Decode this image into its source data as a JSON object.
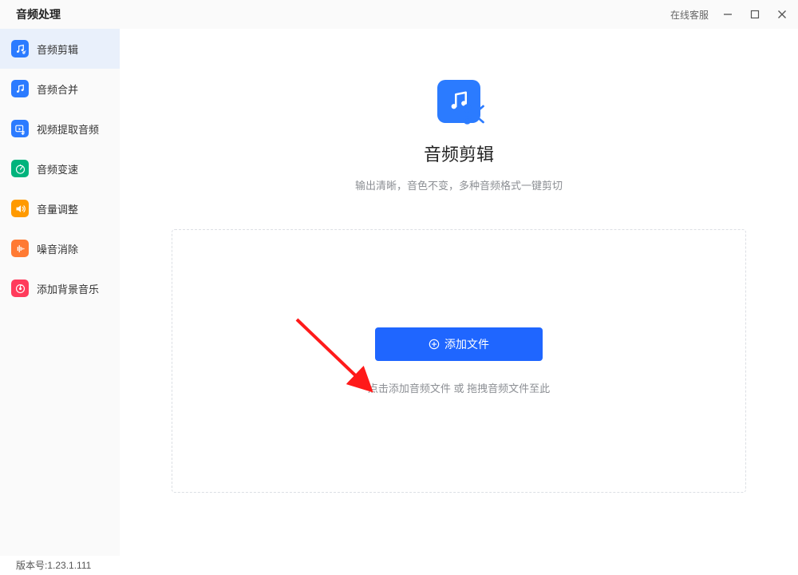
{
  "titlebar": {
    "app_title": "音频处理",
    "support": "在线客服"
  },
  "sidebar": {
    "items": [
      {
        "label": "音频剪辑",
        "icon": "music-cut-icon",
        "color": "#2b7bff",
        "active": true
      },
      {
        "label": "音频合并",
        "icon": "music-merge-icon",
        "color": "#2b7bff",
        "active": false
      },
      {
        "label": "视频提取音频",
        "icon": "video-extract-icon",
        "color": "#2b7bff",
        "active": false
      },
      {
        "label": "音频变速",
        "icon": "speed-icon",
        "color": "#00b37c",
        "active": false
      },
      {
        "label": "音量调整",
        "icon": "volume-icon",
        "color": "#ff9a00",
        "active": false
      },
      {
        "label": "噪音消除",
        "icon": "noise-icon",
        "color": "#ff7a33",
        "active": false
      },
      {
        "label": "添加背景音乐",
        "icon": "bgm-icon",
        "color": "#ff3b5b",
        "active": false
      }
    ]
  },
  "main": {
    "hero_title": "音频剪辑",
    "hero_sub": "输出清晰，音色不变，多种音频格式一键剪切",
    "add_button": "添加文件",
    "drop_hint": "点击添加音频文件 或 拖拽音频文件至此"
  },
  "footer": {
    "version_label": "版本号:1.23.1.111"
  }
}
